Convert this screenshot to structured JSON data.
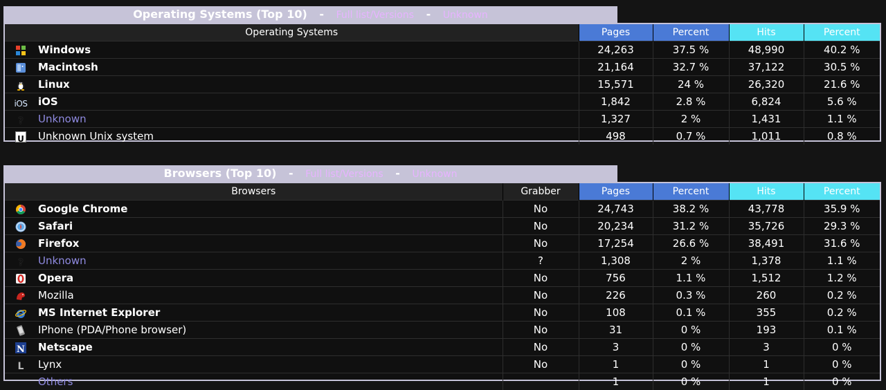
{
  "os": {
    "title": "Operating Systems (Top 10)",
    "sep": "-",
    "link_full": "Full list/Versions",
    "link_unknown": "Unknown",
    "headers": {
      "label": "Operating Systems",
      "pages": "Pages",
      "pct1": "Percent",
      "hits": "Hits",
      "pct2": "Percent"
    },
    "rows": [
      {
        "icon": "windows-icon",
        "name": "Windows",
        "pages": "24,263",
        "pct_pages": "37.5 %",
        "hits": "48,990",
        "pct_hits": "40.2 %"
      },
      {
        "icon": "macintosh-icon",
        "name": "Macintosh",
        "pages": "21,164",
        "pct_pages": "32.7 %",
        "hits": "37,122",
        "pct_hits": "30.5 %"
      },
      {
        "icon": "linux-icon",
        "name": "Linux",
        "pages": "15,571",
        "pct_pages": "24 %",
        "hits": "26,320",
        "pct_hits": "21.6 %"
      },
      {
        "icon": "ios-icon",
        "icon_text": "iOS",
        "name": "iOS",
        "pages": "1,842",
        "pct_pages": "2.8 %",
        "hits": "6,824",
        "pct_hits": "5.6 %"
      },
      {
        "icon": "unknown-icon",
        "icon_text": "?",
        "name": "Unknown",
        "pages": "1,327",
        "pct_pages": "2 %",
        "hits": "1,431",
        "pct_hits": "1.1 %"
      },
      {
        "icon": "unix-icon",
        "icon_text": "U",
        "name": "Unknown Unix system",
        "pages": "498",
        "pct_pages": "0.7 %",
        "hits": "1,011",
        "pct_hits": "0.8 %"
      }
    ]
  },
  "browsers": {
    "title": "Browsers (Top 10)",
    "sep": "-",
    "link_full": "Full list/Versions",
    "link_unknown": "Unknown",
    "headers": {
      "label": "Browsers",
      "grabber": "Grabber",
      "pages": "Pages",
      "pct1": "Percent",
      "hits": "Hits",
      "pct2": "Percent"
    },
    "rows": [
      {
        "icon": "chrome-icon",
        "name": "Google Chrome",
        "grabber": "No",
        "pages": "24,743",
        "pct_pages": "38.2 %",
        "hits": "43,778",
        "pct_hits": "35.9 %"
      },
      {
        "icon": "safari-icon",
        "name": "Safari",
        "grabber": "No",
        "pages": "20,234",
        "pct_pages": "31.2 %",
        "hits": "35,726",
        "pct_hits": "29.3 %"
      },
      {
        "icon": "firefox-icon",
        "name": "Firefox",
        "grabber": "No",
        "pages": "17,254",
        "pct_pages": "26.6 %",
        "hits": "38,491",
        "pct_hits": "31.6 %"
      },
      {
        "icon": "unknown-icon",
        "icon_text": "?",
        "name": "Unknown",
        "grabber": "?",
        "pages": "1,308",
        "pct_pages": "2 %",
        "hits": "1,378",
        "pct_hits": "1.1 %"
      },
      {
        "icon": "opera-icon",
        "name": "Opera",
        "grabber": "No",
        "pages": "756",
        "pct_pages": "1.1 %",
        "hits": "1,512",
        "pct_hits": "1.2 %"
      },
      {
        "icon": "mozilla-icon",
        "name": "Mozilla",
        "grabber": "No",
        "pages": "226",
        "pct_pages": "0.3 %",
        "hits": "260",
        "pct_hits": "0.2 %"
      },
      {
        "icon": "ie-icon",
        "name": "MS Internet Explorer",
        "grabber": "No",
        "pages": "108",
        "pct_pages": "0.1 %",
        "hits": "355",
        "pct_hits": "0.2 %"
      },
      {
        "icon": "iphone-icon",
        "name": "IPhone (PDA/Phone browser)",
        "grabber": "No",
        "pages": "31",
        "pct_pages": "0 %",
        "hits": "193",
        "pct_hits": "0.1 %"
      },
      {
        "icon": "netscape-icon",
        "icon_text": "N",
        "name": "Netscape",
        "grabber": "No",
        "pages": "3",
        "pct_pages": "0 %",
        "hits": "3",
        "pct_hits": "0 %"
      },
      {
        "icon": "lynx-icon",
        "icon_text": "L",
        "name": "Lynx",
        "grabber": "No",
        "pages": "1",
        "pct_pages": "0 %",
        "hits": "1",
        "pct_hits": "0 %"
      },
      {
        "icon": "",
        "name": "Others",
        "grabber": "",
        "pages": "1",
        "pct_pages": "0 %",
        "hits": "1",
        "pct_hits": "0 %"
      }
    ]
  }
}
